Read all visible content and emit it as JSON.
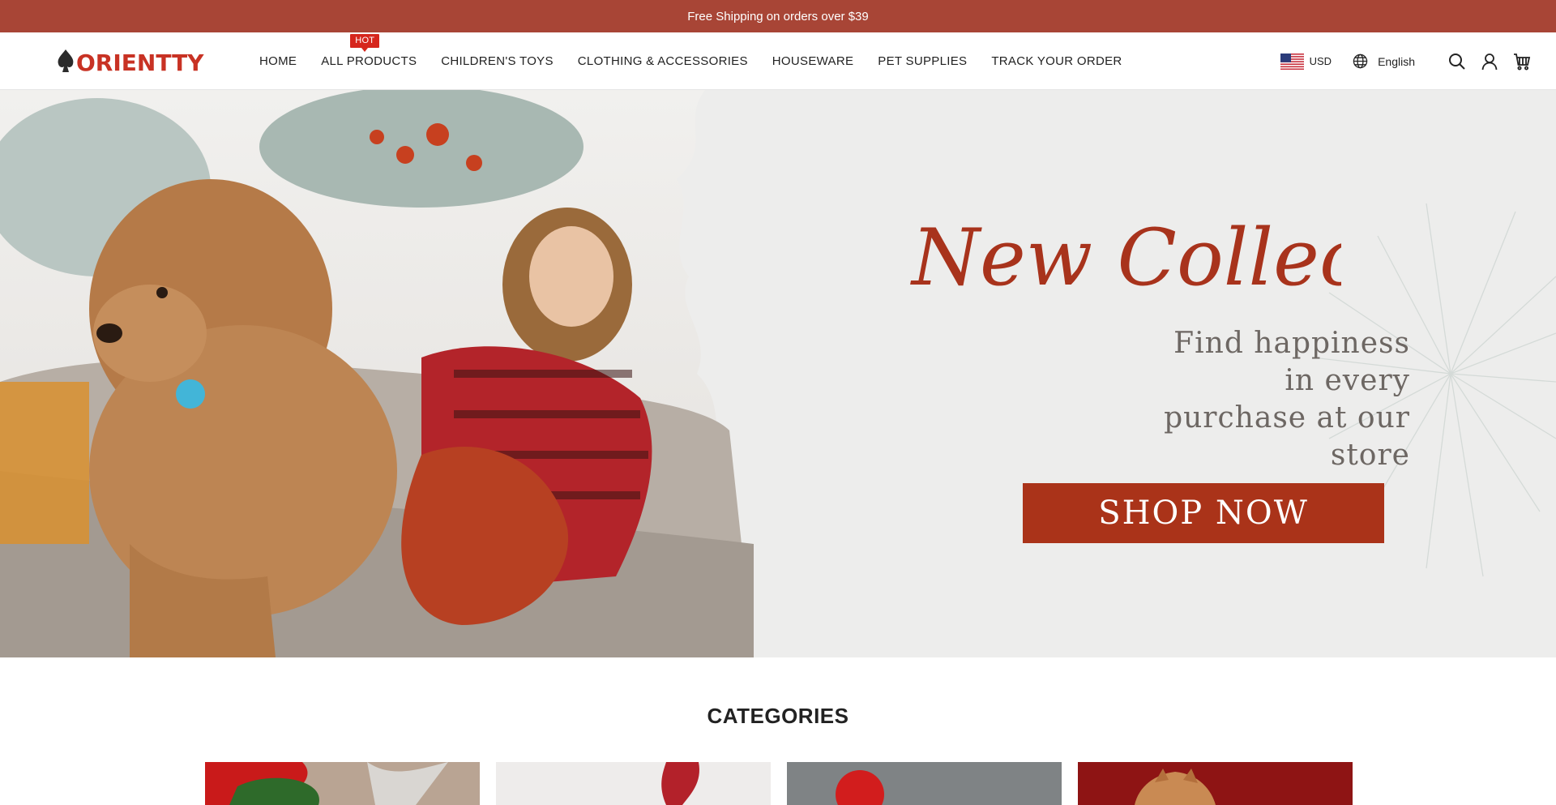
{
  "announcement": {
    "text": "Free Shipping on orders over $39"
  },
  "header": {
    "logo_text": "ORIENTTY",
    "nav": [
      {
        "label": "HOME"
      },
      {
        "label": "ALL PRODUCTS",
        "badge": "HOT"
      },
      {
        "label": "CHILDREN'S TOYS"
      },
      {
        "label": "CLOTHING & ACCESSORIES"
      },
      {
        "label": "HOUSEWARE"
      },
      {
        "label": "PET SUPPLIES"
      },
      {
        "label": "TRACK YOUR ORDER"
      }
    ],
    "currency": "USD",
    "language": "English",
    "icons": [
      "globe-icon",
      "search-icon",
      "account-icon",
      "cart-icon"
    ]
  },
  "hero": {
    "script_title": "New Collection",
    "subtitle": "Find happiness in every purchase at our store",
    "button_label": "SHOP NOW"
  },
  "categories": {
    "title": "CATEGORIES",
    "cards": [
      "category-1",
      "category-2",
      "category-3",
      "category-4"
    ]
  },
  "colors": {
    "brand": "#a84536",
    "button": "#aa3319",
    "badge": "#d6261d"
  }
}
